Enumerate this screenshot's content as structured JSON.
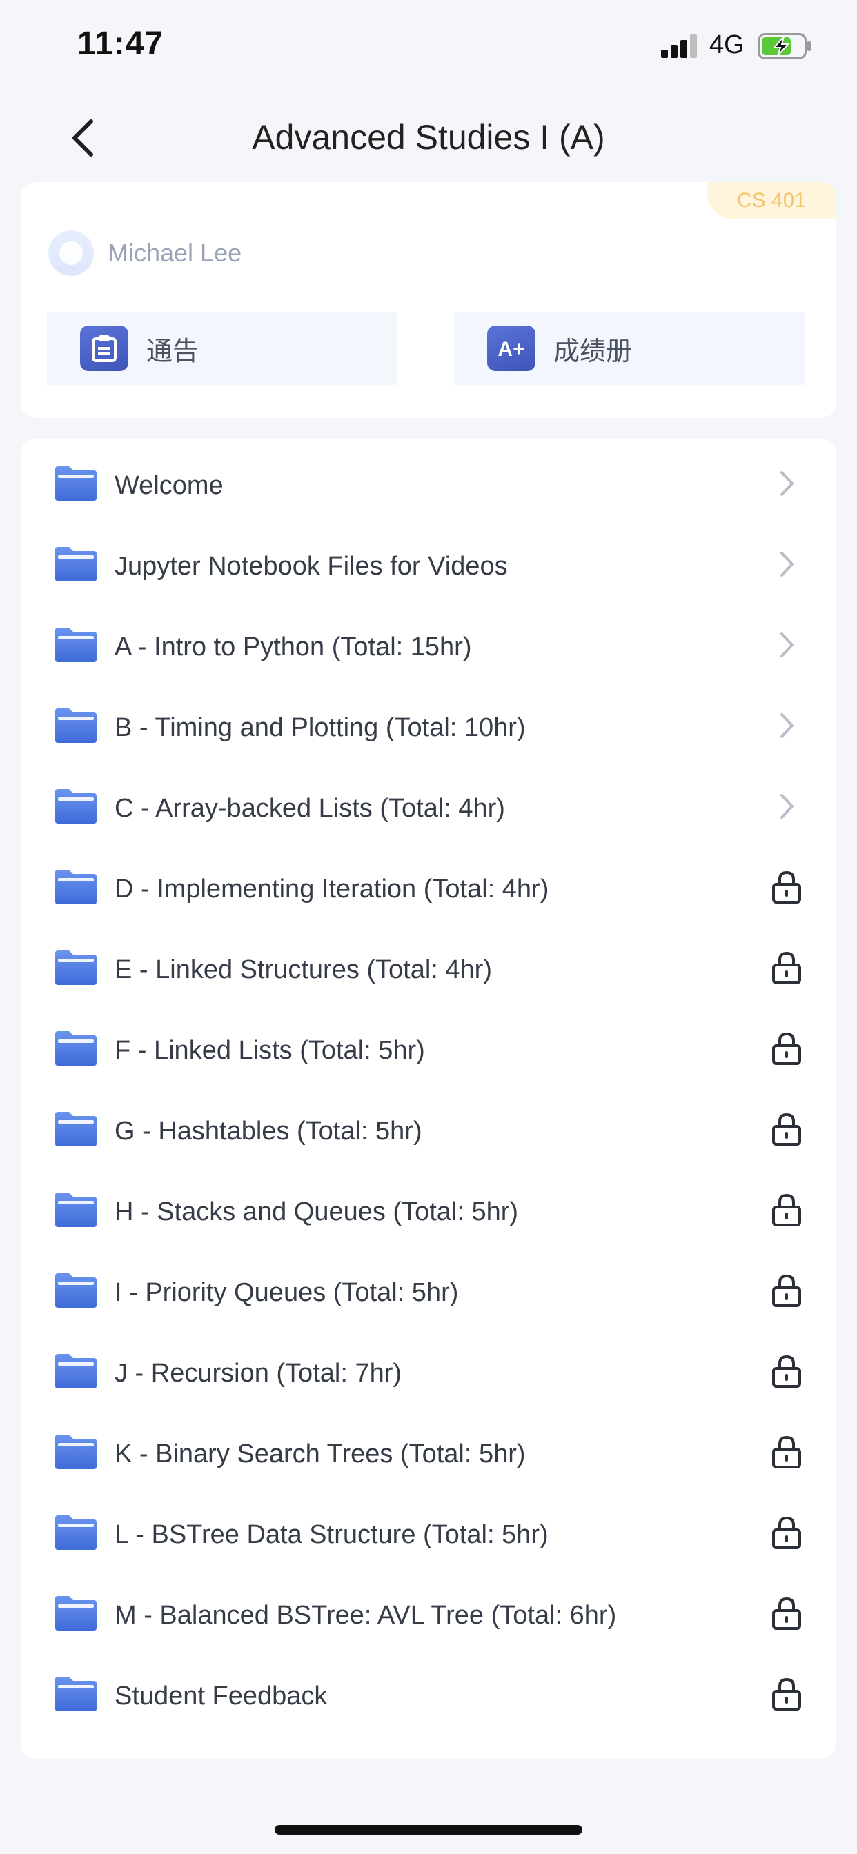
{
  "status_bar": {
    "time": "11:47",
    "network": "4G"
  },
  "nav": {
    "title": "Advanced Studies I (A)"
  },
  "course": {
    "code": "CS 401",
    "instructor": "Michael Lee",
    "actions": [
      {
        "label": "通告",
        "icon": "announcement-icon",
        "color": "#4a62c9"
      },
      {
        "label": "成绩册",
        "icon": "gradebook-icon",
        "color": "#4a62c9"
      }
    ]
  },
  "modules": [
    {
      "label": "Welcome",
      "locked": false
    },
    {
      "label": "Jupyter Notebook Files for Videos",
      "locked": false
    },
    {
      "label": "A - Intro to Python (Total: 15hr)",
      "locked": false
    },
    {
      "label": "B - Timing and Plotting (Total: 10hr)",
      "locked": false
    },
    {
      "label": "C - Array-backed Lists (Total: 4hr)",
      "locked": false
    },
    {
      "label": "D - Implementing Iteration (Total: 4hr)",
      "locked": true
    },
    {
      "label": "E - Linked Structures (Total: 4hr)",
      "locked": true
    },
    {
      "label": "F - Linked Lists (Total: 5hr)",
      "locked": true
    },
    {
      "label": "G - Hashtables (Total: 5hr)",
      "locked": true
    },
    {
      "label": "H - Stacks and Queues (Total: 5hr)",
      "locked": true
    },
    {
      "label": "I - Priority Queues (Total: 5hr)",
      "locked": true
    },
    {
      "label": "J - Recursion (Total: 7hr)",
      "locked": true
    },
    {
      "label": "K - Binary Search Trees (Total: 5hr)",
      "locked": true
    },
    {
      "label": "L - BSTree Data Structure (Total: 5hr)",
      "locked": true
    },
    {
      "label": "M - Balanced BSTree: AVL Tree (Total: 6hr)",
      "locked": true
    },
    {
      "label": "Student Feedback",
      "locked": true
    }
  ],
  "colors": {
    "accent": "#4a62c9",
    "folder": "#4f7de6",
    "course_code_bg": "#fff4dc",
    "course_code_text": "#f3c56d",
    "battery": "#5ac83a"
  }
}
